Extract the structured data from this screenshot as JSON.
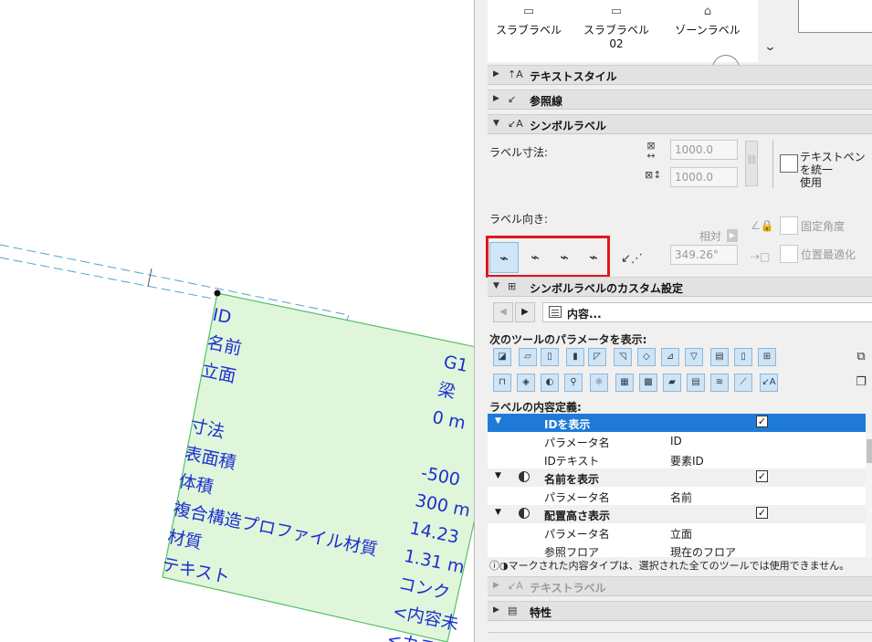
{
  "canvas": {
    "label_lines_left": [
      "ID",
      "名前",
      "立面",
      "",
      "寸法",
      "表面積",
      "体積",
      "複合構造プロファイル材質",
      "材質",
      "テキスト"
    ],
    "label_lines_right": [
      "G1",
      "梁",
      "0 m",
      "",
      "-500",
      "300 m",
      "14.23",
      "1.31 m",
      "コンク",
      "<内容未",
      "<カスタ"
    ],
    "label_fill": "#dff6da",
    "label_border": "#56c066",
    "text_color": "#1f2fd0",
    "ref_line_color": "#4aa6c8"
  },
  "panel": {
    "favorites": {
      "items": [
        {
          "label": "スラブラベル",
          "icon": "slab-label-icon"
        },
        {
          "label": "スラブラベル 02",
          "icon": "slab-label-02-icon"
        },
        {
          "label": "ゾーンラベル",
          "icon": "zone-label-icon"
        }
      ]
    },
    "sections": {
      "text_style": "テキストスタイル",
      "ref_line": "参照線",
      "symbol_label": "シンボルラベル",
      "custom_settings": "シンボルラベルのカスタム設定",
      "text_label": "テキストラベル",
      "properties": "特性"
    },
    "label_size": {
      "label": "ラベル寸法:",
      "width": "1000.0",
      "height": "1000.0",
      "unify_pen_label": "テキストペンを統一\n使用"
    },
    "orientation": {
      "label": "ラベル向き:",
      "relative_label": "相対",
      "angle": "349.26°",
      "fixed_angle_label": "固定角度",
      "optimize_label": "位置最適化",
      "buttons": [
        "A12",
        "A12",
        "A12",
        "A12",
        "A12"
      ]
    },
    "nav": {
      "content_label": "内容..."
    },
    "tool_params_label": "次のツールのパラメータを表示:",
    "content_def_label": "ラベルの内容定義:",
    "table": [
      {
        "type": "header-sel",
        "label": "IDを表示",
        "checked": "✓"
      },
      {
        "type": "row",
        "c1": "パラメータ名",
        "c2": "ID"
      },
      {
        "type": "row",
        "c1": "IDテキスト",
        "c2": "要素ID"
      },
      {
        "type": "header",
        "label": "名前を表示",
        "checked": "✓"
      },
      {
        "type": "row",
        "c1": "パラメータ名",
        "c2": "名前"
      },
      {
        "type": "header",
        "label": "配置高さ表示",
        "checked": "✓"
      },
      {
        "type": "row",
        "c1": "パラメータ名",
        "c2": "立面"
      },
      {
        "type": "row",
        "c1": "参照フロア",
        "c2": "現在のフロア"
      }
    ],
    "note": "マークされた内容タイプは、選択された全てのツールでは使用できません。",
    "highlight_color": "#e4161c",
    "selection_color": "#1e7ad6"
  }
}
